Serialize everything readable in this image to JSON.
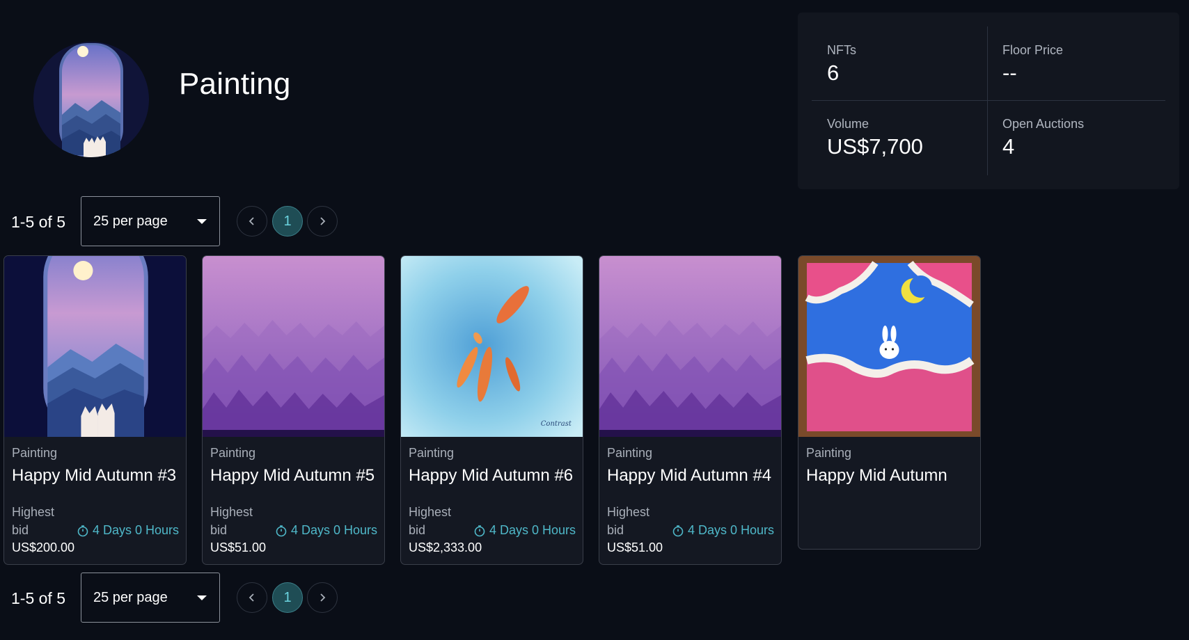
{
  "collection": {
    "title": "Painting"
  },
  "stats": [
    {
      "label": "NFTs",
      "value": "6"
    },
    {
      "label": "Floor Price",
      "value": "--"
    },
    {
      "label": "Volume",
      "value": "US$7,700"
    },
    {
      "label": "Open Auctions",
      "value": "4"
    }
  ],
  "pagination": {
    "count_text": "1-5 of 5",
    "per_page": "25 per page",
    "current_page": "1",
    "prev_icon": "chevron-left-icon",
    "next_icon": "chevron-right-icon"
  },
  "cards": [
    {
      "category": "Painting",
      "name": "Happy Mid Autumn #3",
      "bid_label_1": "Highest",
      "bid_label_2": "bid",
      "timer": "4 Days 0 Hours",
      "price": "US$200.00",
      "image": "moon-window-cats"
    },
    {
      "category": "Painting",
      "name": "Happy Mid Autumn #5",
      "bid_label_1": "Highest",
      "bid_label_2": "bid",
      "timer": "4 Days 0 Hours",
      "price": "US$51.00",
      "image": "purple-forest"
    },
    {
      "category": "Painting",
      "name": "Happy Mid Autumn #6",
      "bid_label_1": "Highest",
      "bid_label_2": "bid",
      "timer": "4 Days 0 Hours",
      "price": "US$2,333.00",
      "image": "koi-fish-pond"
    },
    {
      "category": "Painting",
      "name": "Happy Mid Autumn #4",
      "bid_label_1": "Highest",
      "bid_label_2": "bid",
      "timer": "4 Days 0 Hours",
      "price": "US$51.00",
      "image": "purple-forest"
    },
    {
      "category": "Painting",
      "name": "Happy Mid Autumn",
      "image": "bunny-pink-clouds"
    }
  ],
  "colors": {
    "background": "#0a0e17",
    "panel": "#12161f",
    "accent": "#4fb8c9",
    "active_page_bg": "#1f4d55"
  }
}
